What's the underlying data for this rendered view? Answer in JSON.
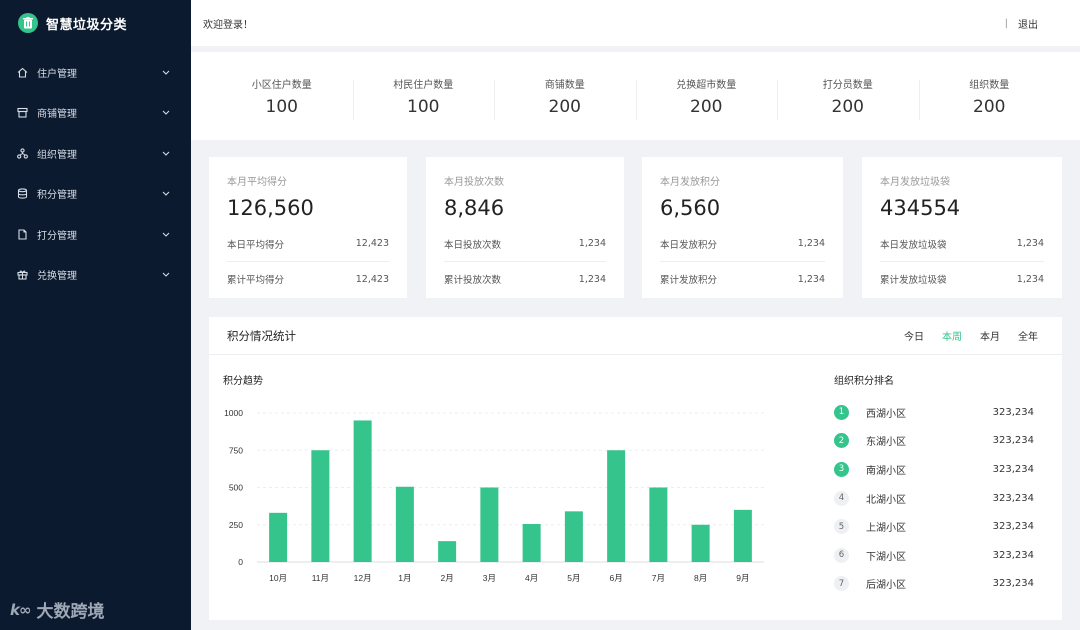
{
  "brand": {
    "title": "智慧垃圾分类"
  },
  "sidebar": {
    "items": [
      {
        "label": "住户管理",
        "icon": "home-icon"
      },
      {
        "label": "商铺管理",
        "icon": "shop-icon"
      },
      {
        "label": "组织管理",
        "icon": "org-icon"
      },
      {
        "label": "积分管理",
        "icon": "database-icon"
      },
      {
        "label": "打分管理",
        "icon": "document-icon"
      },
      {
        "label": "兑换管理",
        "icon": "gift-icon"
      }
    ]
  },
  "watermark": {
    "text": "大数跨境"
  },
  "header": {
    "welcome": "欢迎登录！",
    "separator": "|",
    "logout": "退出"
  },
  "counts": [
    {
      "label": "小区住户数量",
      "value": "100"
    },
    {
      "label": "村民住户数量",
      "value": "100"
    },
    {
      "label": "商铺数量",
      "value": "200"
    },
    {
      "label": "兑换超市数量",
      "value": "200"
    },
    {
      "label": "打分员数量",
      "value": "200"
    },
    {
      "label": "组织数量",
      "value": "200"
    }
  ],
  "cards": [
    {
      "title": "本月平均得分",
      "value": "126,560",
      "rows": [
        {
          "label": "本日平均得分",
          "value": "12,423"
        },
        {
          "label": "累计平均得分",
          "value": "12,423"
        }
      ]
    },
    {
      "title": "本月投放次数",
      "value": "8,846",
      "rows": [
        {
          "label": "本日投放次数",
          "value": "1,234"
        },
        {
          "label": "累计投放次数",
          "value": "1,234"
        }
      ]
    },
    {
      "title": "本月发放积分",
      "value": "6,560",
      "rows": [
        {
          "label": "本日发放积分",
          "value": "1,234"
        },
        {
          "label": "累计发放积分",
          "value": "1,234"
        }
      ]
    },
    {
      "title": "本月发放垃圾袋",
      "value": "434554",
      "rows": [
        {
          "label": "本日发放垃圾袋",
          "value": "1,234"
        },
        {
          "label": "累计发放垃圾袋",
          "value": "1,234"
        }
      ]
    }
  ],
  "panel": {
    "title": "积分情况统计",
    "tabs": [
      {
        "label": "今日",
        "active": false
      },
      {
        "label": "本周",
        "active": true
      },
      {
        "label": "本月",
        "active": false
      },
      {
        "label": "全年",
        "active": false
      }
    ],
    "trend_title": "积分趋势",
    "rank_title": "组织积分排名",
    "ranking": [
      {
        "rank": "1",
        "name": "西湖小区",
        "value": "323,234"
      },
      {
        "rank": "2",
        "name": "东湖小区",
        "value": "323,234"
      },
      {
        "rank": "3",
        "name": "南湖小区",
        "value": "323,234"
      },
      {
        "rank": "4",
        "name": "北湖小区",
        "value": "323,234"
      },
      {
        "rank": "5",
        "name": "上湖小区",
        "value": "323,234"
      },
      {
        "rank": "6",
        "name": "下湖小区",
        "value": "323,234"
      },
      {
        "rank": "7",
        "name": "后湖小区",
        "value": "323,234"
      }
    ]
  },
  "colors": {
    "accent": "#35c48c",
    "sidebar_bg": "#0b1a2e",
    "page_bg": "#f0f2f5"
  },
  "chart_data": {
    "type": "bar",
    "title": "积分趋势",
    "categories": [
      "10月",
      "11月",
      "12月",
      "1月",
      "2月",
      "3月",
      "4月",
      "5月",
      "6月",
      "7月",
      "8月",
      "9月"
    ],
    "values": [
      330,
      750,
      950,
      505,
      140,
      500,
      255,
      340,
      750,
      500,
      250,
      350
    ],
    "yticks": [
      "0",
      "250",
      "500",
      "750",
      "1000"
    ],
    "ylim": [
      0,
      1000
    ],
    "grid": true,
    "color": "#35c48c"
  }
}
